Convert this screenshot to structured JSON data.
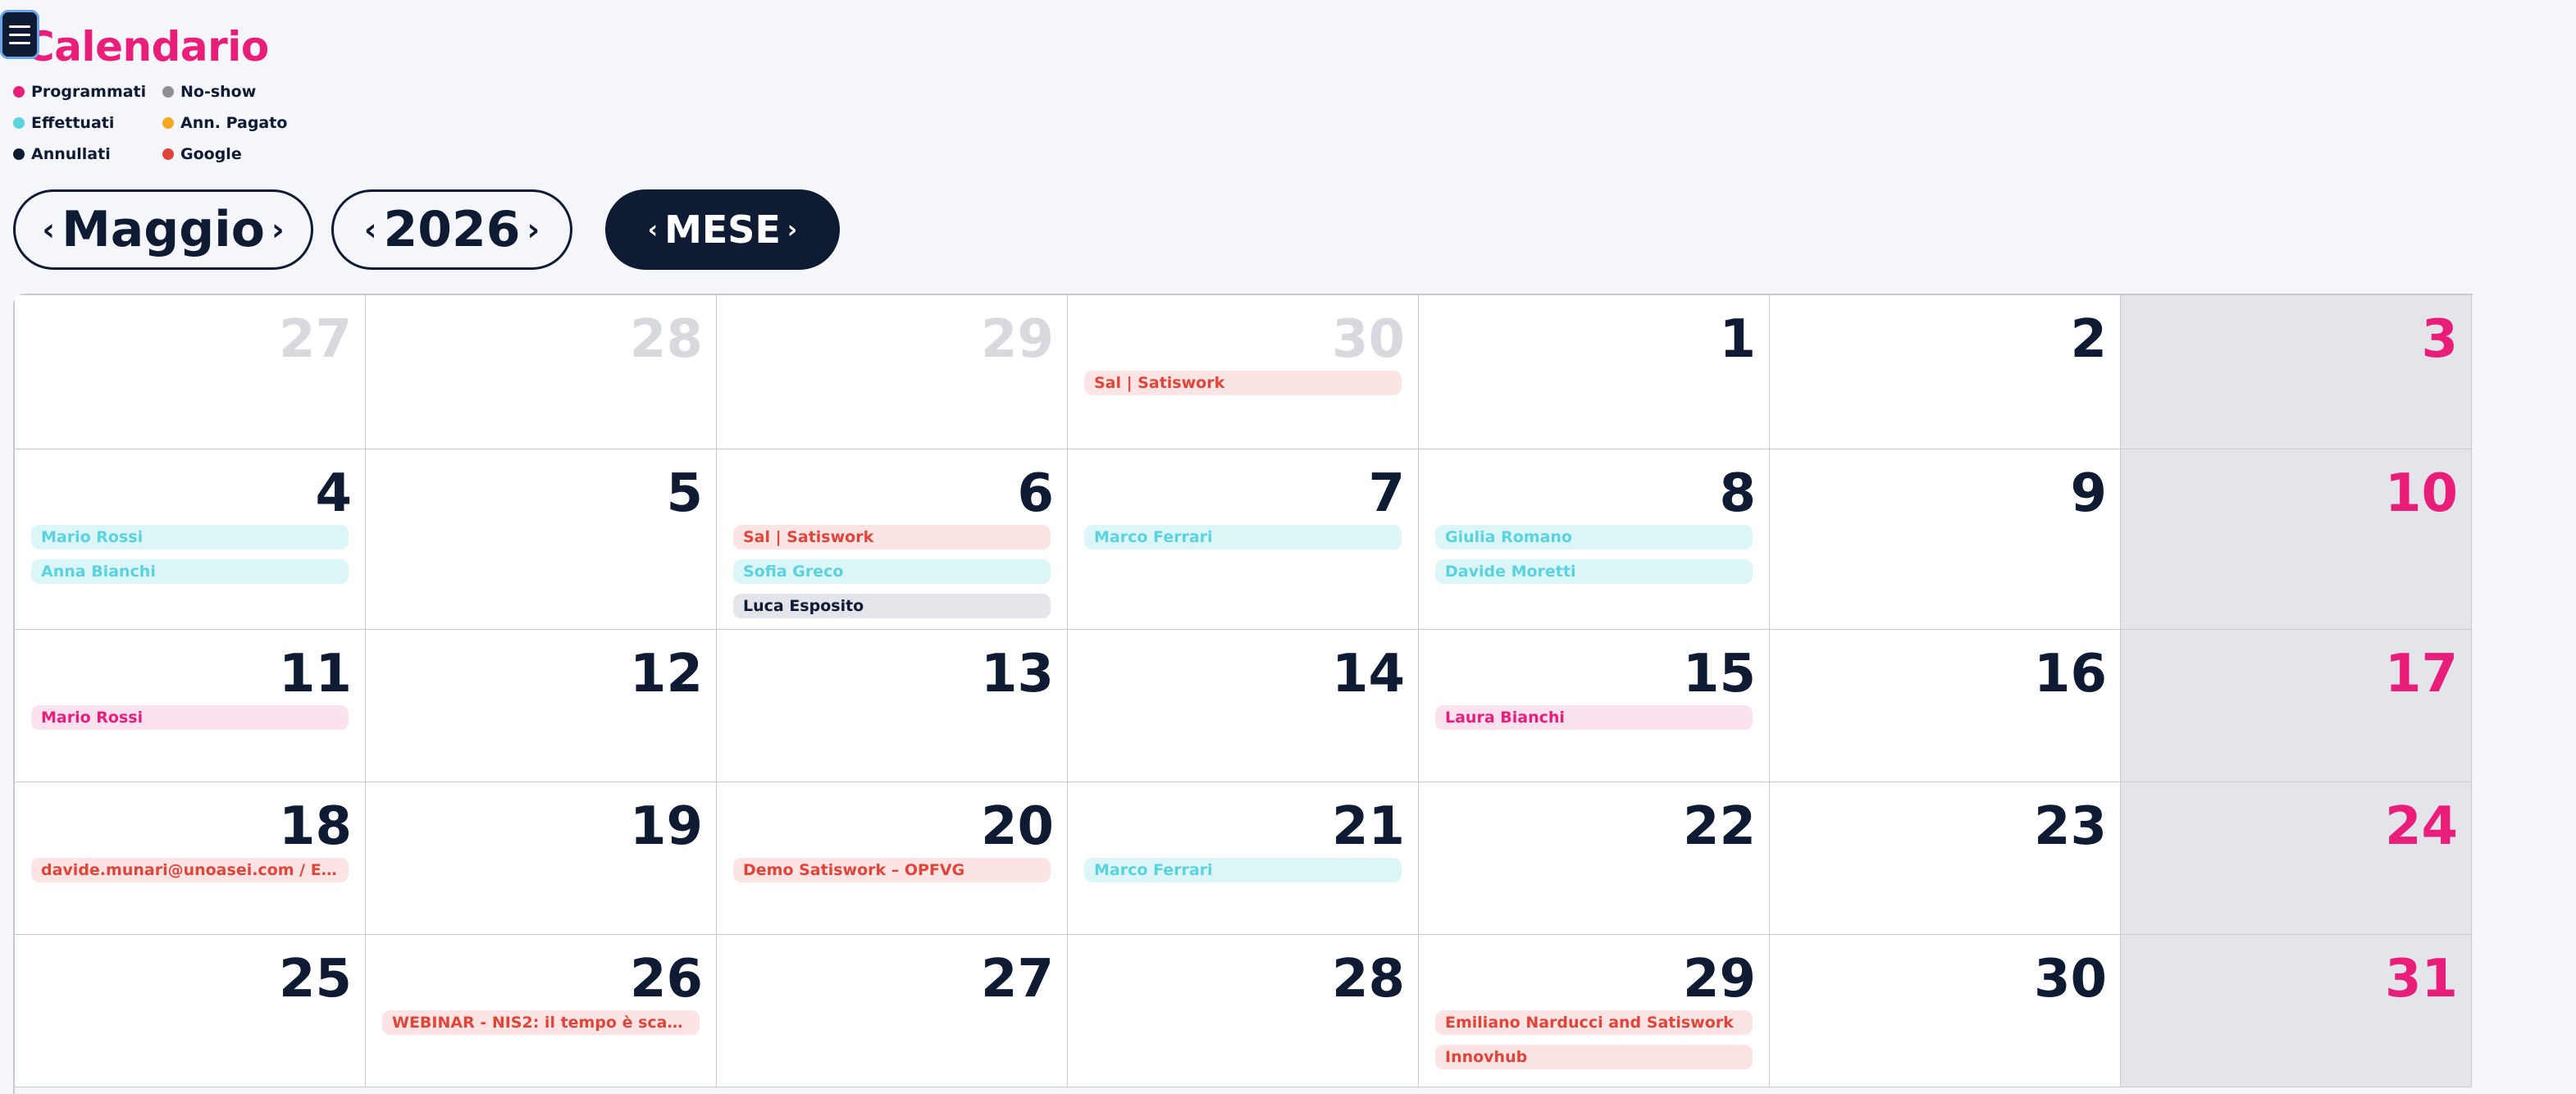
{
  "header": {
    "title": "Calendario",
    "menu_icon": "hamburger-icon"
  },
  "legend": [
    {
      "label": "Programmati",
      "color": "#e91e7a"
    },
    {
      "label": "No-show",
      "color": "#8f9096"
    },
    {
      "label": "Effettuati",
      "color": "#5ad3de"
    },
    {
      "label": "Ann. Pagato",
      "color": "#f5a623"
    },
    {
      "label": "Annullati",
      "color": "#0f1a33"
    },
    {
      "label": "Google",
      "color": "#e0453a"
    }
  ],
  "nav": {
    "prev_glyph": "‹",
    "next_glyph": "›",
    "month": "Maggio",
    "year": "2026",
    "view": "MESE"
  },
  "colors": {
    "accent": "#e91e7a",
    "dark": "#0f1a33",
    "google": "#e0453a",
    "effettuati": "#5ad3de"
  },
  "weeks": [
    [
      {
        "day": "27",
        "other": true,
        "events": []
      },
      {
        "day": "28",
        "other": true,
        "events": []
      },
      {
        "day": "29",
        "other": true,
        "events": []
      },
      {
        "day": "30",
        "other": true,
        "events": [
          {
            "label": "Sal | Satiswork",
            "type": "google"
          }
        ]
      },
      {
        "day": "1",
        "events": []
      },
      {
        "day": "2",
        "events": []
      },
      {
        "day": "3",
        "sunday": true,
        "events": []
      }
    ],
    [
      {
        "day": "4",
        "events": [
          {
            "label": "Mario Rossi",
            "type": "effettuati"
          },
          {
            "label": "Anna Bianchi",
            "type": "effettuati"
          }
        ]
      },
      {
        "day": "5",
        "events": []
      },
      {
        "day": "6",
        "events": [
          {
            "label": "Sal | Satiswork",
            "type": "google"
          },
          {
            "label": "Sofia Greco",
            "type": "effettuati"
          },
          {
            "label": "Luca Esposito",
            "type": "annullati"
          }
        ]
      },
      {
        "day": "7",
        "events": [
          {
            "label": "Marco Ferrari",
            "type": "effettuati"
          }
        ]
      },
      {
        "day": "8",
        "events": [
          {
            "label": "Giulia Romano",
            "type": "effettuati"
          },
          {
            "label": "Davide Moretti",
            "type": "effettuati"
          }
        ]
      },
      {
        "day": "9",
        "events": []
      },
      {
        "day": "10",
        "sunday": true,
        "events": []
      }
    ],
    [
      {
        "day": "11",
        "events": [
          {
            "label": "Mario Rossi",
            "type": "programmati"
          }
        ]
      },
      {
        "day": "12",
        "events": []
      },
      {
        "day": "13",
        "events": []
      },
      {
        "day": "14",
        "events": []
      },
      {
        "day": "15",
        "events": [
          {
            "label": "Laura Bianchi",
            "type": "programmati"
          }
        ]
      },
      {
        "day": "16",
        "events": []
      },
      {
        "day": "17",
        "sunday": true,
        "events": []
      }
    ],
    [
      {
        "day": "18",
        "events": [
          {
            "label": "davide.munari@unoasei.com / E...",
            "type": "google"
          }
        ]
      },
      {
        "day": "19",
        "events": []
      },
      {
        "day": "20",
        "events": [
          {
            "label": "Demo Satiswork – OPFVG",
            "type": "google"
          }
        ]
      },
      {
        "day": "21",
        "events": [
          {
            "label": "Marco Ferrari",
            "type": "effettuati"
          }
        ]
      },
      {
        "day": "22",
        "events": []
      },
      {
        "day": "23",
        "events": []
      },
      {
        "day": "24",
        "sunday": true,
        "events": []
      }
    ],
    [
      {
        "day": "25",
        "events": []
      },
      {
        "day": "26",
        "events": [
          {
            "label": "WEBINAR - NIS2: il tempo è scad...",
            "type": "google"
          }
        ]
      },
      {
        "day": "27",
        "events": []
      },
      {
        "day": "28",
        "events": []
      },
      {
        "day": "29",
        "events": [
          {
            "label": "Emiliano Narducci and Satiswork",
            "type": "google"
          },
          {
            "label": "Innovhub",
            "type": "google"
          }
        ]
      },
      {
        "day": "30",
        "events": []
      },
      {
        "day": "31",
        "sunday": true,
        "events": []
      }
    ]
  ]
}
